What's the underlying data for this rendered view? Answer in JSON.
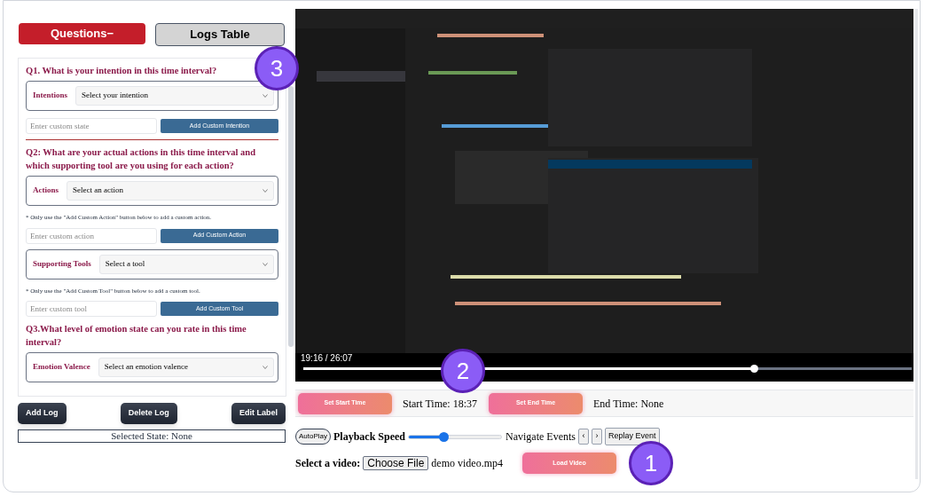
{
  "left_tabs": [
    {
      "label": "Questions−",
      "selected": true
    },
    {
      "label": "Logs Table",
      "selected": false
    }
  ],
  "questions": [
    {
      "title": "Q1. What is your intention in this time interval?",
      "divider": true,
      "items": [
        {
          "kind": "select",
          "label": "Intentions",
          "value": "Select your intention"
        },
        {
          "kind": "custom",
          "placeholder": "Enter custom state",
          "button": "Add Custom Intention"
        }
      ]
    },
    {
      "title": "Q2: What are your actual actions in this time interval and which supporting tool are you using for each action?",
      "divider": false,
      "items": [
        {
          "kind": "select",
          "label": "Actions",
          "value": "Select an action"
        },
        {
          "kind": "note",
          "text": "* Only use the \"Add Custom Action\" button below to add a custom action."
        },
        {
          "kind": "custom",
          "placeholder": "Enter custom action",
          "button": "Add Custom Action"
        },
        {
          "kind": "select",
          "label": "Supporting Tools",
          "value": "Select a tool"
        },
        {
          "kind": "note",
          "text": "* Only use the \"Add Custom Tool\" button below to add a custom tool."
        },
        {
          "kind": "custom",
          "placeholder": "Enter custom tool",
          "button": "Add Custom Tool"
        }
      ]
    },
    {
      "title": "Q3.What level of emotion state can you rate in this time interval?",
      "divider": false,
      "items": [
        {
          "kind": "select",
          "label": "Emotion Valence",
          "value": "Select an emotion valence"
        }
      ]
    }
  ],
  "log_buttons": [
    "Add Log",
    "Delete Log",
    "Edit Label"
  ],
  "selected_state": "Selected State: None",
  "player": {
    "time": "19:16 / 26:07",
    "level": 0.74
  },
  "time_row": {
    "set_start": "Set Start Time",
    "start": "Start Time: 18:37",
    "set_end": "Set End Time",
    "end": "End Time: None"
  },
  "controls": {
    "autoplay": "AutoPlay",
    "speed_label": "Playback Speed",
    "speed": {
      "level": 0.37
    },
    "navigate": "Navigate Events",
    "prev": "‹",
    "next": "›",
    "replay": "Replay Event"
  },
  "file_row": {
    "label": "Select a video:",
    "choose": "Choose File",
    "file": "demo video.mp4",
    "load": "Load Video"
  },
  "badges": [
    "3",
    "2",
    "1"
  ]
}
